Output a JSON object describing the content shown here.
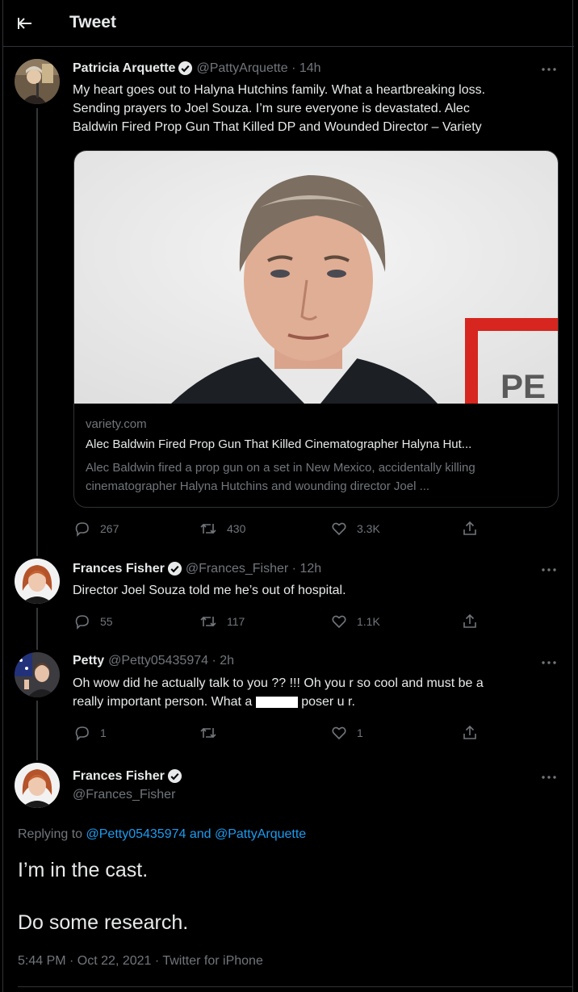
{
  "header": {
    "title": "Tweet"
  },
  "tweets": [
    {
      "display_name": "Patricia Arquette",
      "handle_time": "@PattyArquette · 14h",
      "text_lines": [
        "My heart goes out to Halyna Hutchins family.  What a heartbreaking loss.",
        "Sending prayers to Joel Souza. I’m sure everyone is devastated. Alec",
        "Baldwin Fired Prop Gun That Killed DP and Wounded Director – Variety"
      ],
      "card": {
        "domain": "variety.com",
        "title": "Alec Baldwin Fired Prop Gun That Killed Cinematographer Halyna Hut...",
        "description": "Alec Baldwin fired a prop gun on a set in New Mexico, accidentally killing cinematographer Halyna Hutchins and wounding director Joel ...",
        "image_text": "PE"
      },
      "replies": "267",
      "retweets": "430",
      "likes": "3.3K"
    },
    {
      "display_name": "Frances Fisher",
      "handle_time": "@Frances_Fisher · 12h",
      "text": "Director Joel Souza told me he’s out of hospital.",
      "replies": "55",
      "retweets": "117",
      "likes": "1.1K"
    },
    {
      "display_name": "Petty",
      "handle_time": "@Petty05435974 · 2h",
      "text_line1": "Oh wow did he actually talk to you ?? !!! Oh you r so cool and must be a",
      "text_line2_a": "really important person. What a ",
      "text_line2_b": " poser u r.",
      "replies": "1",
      "retweets": "",
      "likes": "1"
    }
  ],
  "main_tweet": {
    "display_name": "Frances Fisher",
    "handle": "@Frances_Fisher",
    "replying_prefix": "Replying to ",
    "replying_user1": "@Petty05435974",
    "replying_and": " and ",
    "replying_user2": "@PattyArquette",
    "line1": "I’m in the cast.",
    "line2": "Do some research.",
    "timestamp": "5:44 PM · Oct 22, 2021 · Twitter for iPhone"
  },
  "colors": {
    "background": "#000000",
    "text": "#e7e9ea",
    "secondary": "#71767b",
    "link": "#1d9bf0",
    "verified": "#e7e9ea",
    "border": "#2f3336"
  },
  "icons": [
    "back-arrow-icon",
    "verified-icon",
    "more-icon",
    "reply-icon",
    "retweet-icon",
    "like-icon",
    "share-icon"
  ]
}
